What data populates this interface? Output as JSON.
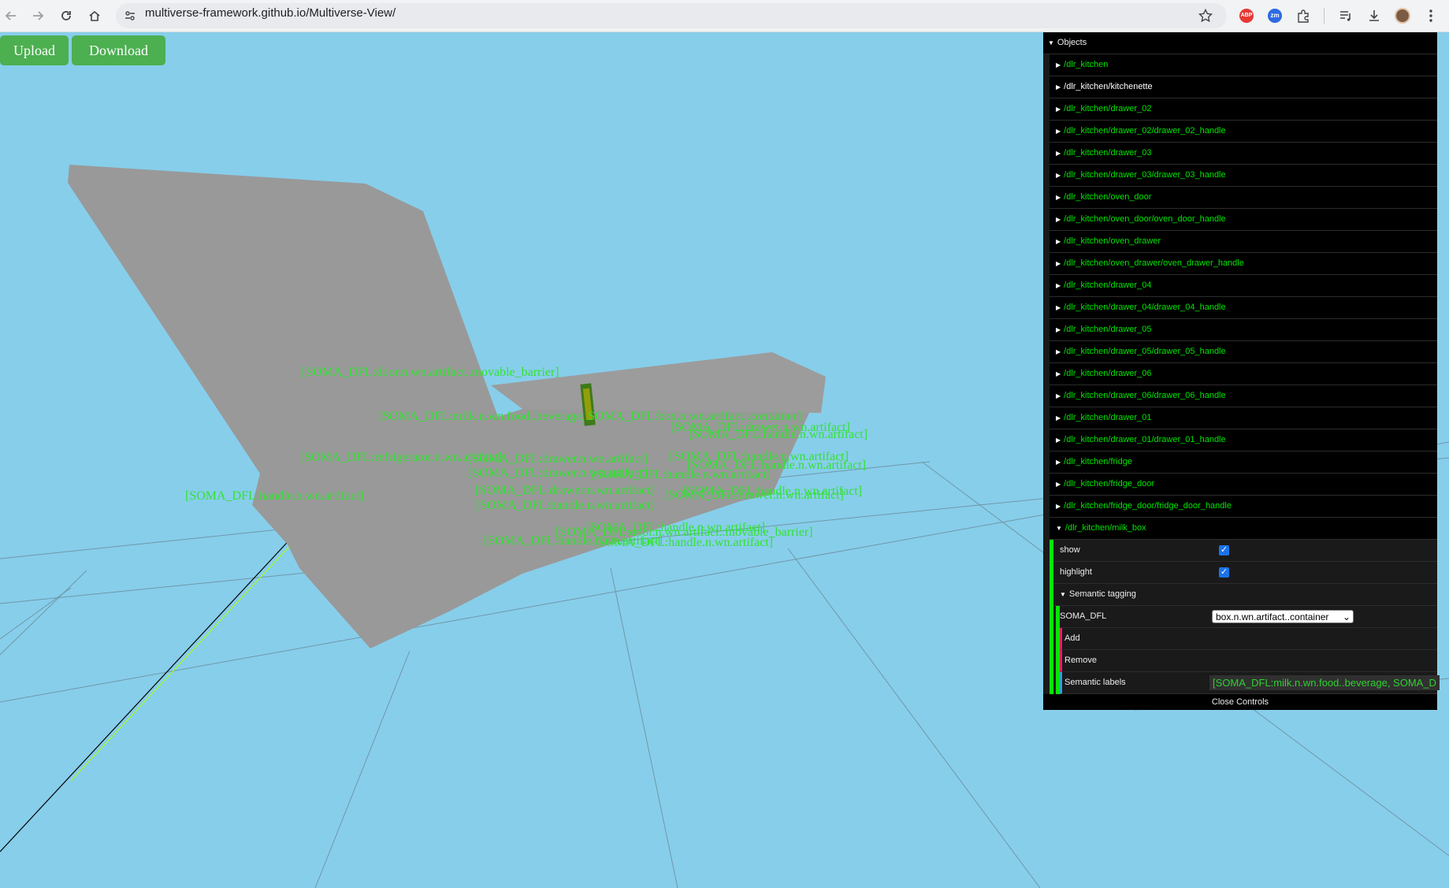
{
  "browser": {
    "url": "multiverse-framework.github.io/Multiverse-View/"
  },
  "toolbar": {
    "upload_label": "Upload",
    "download_label": "Download"
  },
  "gui": {
    "folder_title": "Objects",
    "objects": [
      "/dlr_kitchen",
      "/dlr_kitchen/kitchenette",
      "/dlr_kitchen/drawer_02",
      "/dlr_kitchen/drawer_02/drawer_02_handle",
      "/dlr_kitchen/drawer_03",
      "/dlr_kitchen/drawer_03/drawer_03_handle",
      "/dlr_kitchen/oven_door",
      "/dlr_kitchen/oven_door/oven_door_handle",
      "/dlr_kitchen/oven_drawer",
      "/dlr_kitchen/oven_drawer/oven_drawer_handle",
      "/dlr_kitchen/drawer_04",
      "/dlr_kitchen/drawer_04/drawer_04_handle",
      "/dlr_kitchen/drawer_05",
      "/dlr_kitchen/drawer_05/drawer_05_handle",
      "/dlr_kitchen/drawer_06",
      "/dlr_kitchen/drawer_06/drawer_06_handle",
      "/dlr_kitchen/drawer_01",
      "/dlr_kitchen/drawer_01/drawer_01_handle",
      "/dlr_kitchen/fridge",
      "/dlr_kitchen/fridge_door",
      "/dlr_kitchen/fridge_door/fridge_door_handle"
    ],
    "expanded_object": "/dlr_kitchen/milk_box",
    "show_label": "show",
    "show_checked": true,
    "highlight_label": "highlight",
    "highlight_checked": true,
    "semantic_folder": "Semantic tagging",
    "ontology_label": "SOMA_DFL",
    "ontology_selected": "box.n.wn.artifact..container",
    "add_label": "Add",
    "remove_label": "Remove",
    "semantic_labels_label": "Semantic labels",
    "semantic_labels_value": "[SOMA_DFL:milk.n.wn.food..beverage, SOMA_D",
    "close_controls": "Close Controls"
  },
  "scene_labels": [
    "[SOMA_DFL:door.n.wn.artifact..movable_barrier]",
    "[SOMA_DFL:milk.n.wn.food..beverage, SOMA_DFL:box.n.wn.artifact..container]",
    "[SOMA_DFL:drawer.n.wn.artifact]",
    "[SOMA_DFL:handle.n.wn.artifact]",
    "[SOMA_DFL:refrigerator.n.wn.artifact]",
    "[SOMA_DFL:drawer.n.wn.artifact]",
    "[SOMA_DFL:handle.n.wn.artifact]",
    "[SOMA_DFL:handle.n.wn.artifact]",
    "[SOMA_DFL:drawer.n.wn.artifact]",
    "[SOMA_DFL:handle.n.wn.artifact]",
    "[SOMA_DFL:handle.n.wn.artifact]",
    "[SOMA_DFL:drawer.n.wn.artifact]",
    "[SOMA_DFL:handle.n.wn.artifact]",
    "[SOMA_DFL:handle.n.wn.artifact]",
    "[SOMA_DFL:drawer.n.wn.artifact]",
    "[SOMA_DFL:handle.n.wn.artifact]",
    "[SOMA_DFL:door.n.wn.artifact..movable_barrier]",
    "[SOMA_DFL:handle.n.wn.artifact]",
    "[SOMA_DFL:handle.n.wn.artifact]"
  ]
}
